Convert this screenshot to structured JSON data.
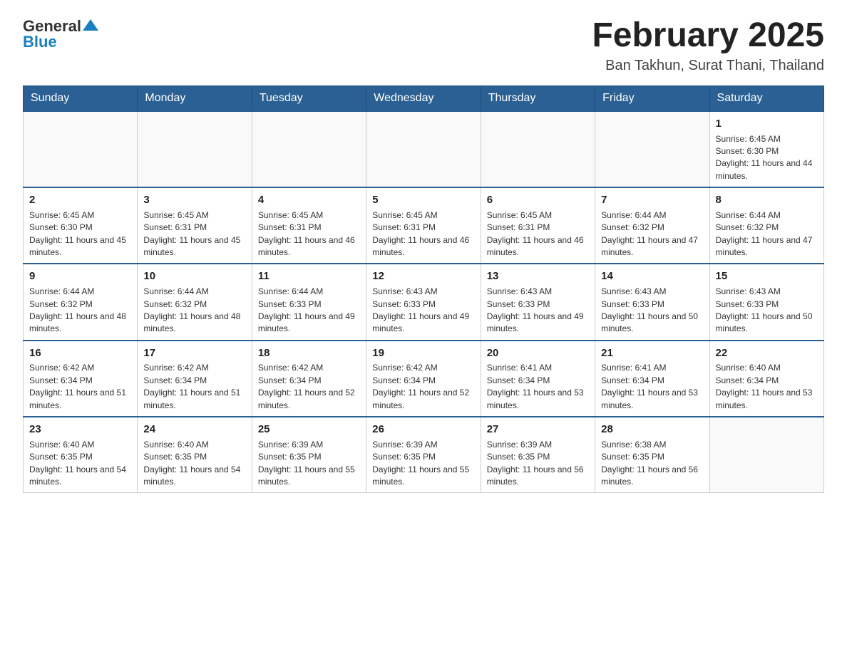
{
  "header": {
    "logo_general": "General",
    "logo_blue": "Blue",
    "month_year": "February 2025",
    "location": "Ban Takhun, Surat Thani, Thailand"
  },
  "days_of_week": [
    "Sunday",
    "Monday",
    "Tuesday",
    "Wednesday",
    "Thursday",
    "Friday",
    "Saturday"
  ],
  "weeks": [
    [
      {
        "day": "",
        "info": ""
      },
      {
        "day": "",
        "info": ""
      },
      {
        "day": "",
        "info": ""
      },
      {
        "day": "",
        "info": ""
      },
      {
        "day": "",
        "info": ""
      },
      {
        "day": "",
        "info": ""
      },
      {
        "day": "1",
        "info": "Sunrise: 6:45 AM\nSunset: 6:30 PM\nDaylight: 11 hours and 44 minutes."
      }
    ],
    [
      {
        "day": "2",
        "info": "Sunrise: 6:45 AM\nSunset: 6:30 PM\nDaylight: 11 hours and 45 minutes."
      },
      {
        "day": "3",
        "info": "Sunrise: 6:45 AM\nSunset: 6:31 PM\nDaylight: 11 hours and 45 minutes."
      },
      {
        "day": "4",
        "info": "Sunrise: 6:45 AM\nSunset: 6:31 PM\nDaylight: 11 hours and 46 minutes."
      },
      {
        "day": "5",
        "info": "Sunrise: 6:45 AM\nSunset: 6:31 PM\nDaylight: 11 hours and 46 minutes."
      },
      {
        "day": "6",
        "info": "Sunrise: 6:45 AM\nSunset: 6:31 PM\nDaylight: 11 hours and 46 minutes."
      },
      {
        "day": "7",
        "info": "Sunrise: 6:44 AM\nSunset: 6:32 PM\nDaylight: 11 hours and 47 minutes."
      },
      {
        "day": "8",
        "info": "Sunrise: 6:44 AM\nSunset: 6:32 PM\nDaylight: 11 hours and 47 minutes."
      }
    ],
    [
      {
        "day": "9",
        "info": "Sunrise: 6:44 AM\nSunset: 6:32 PM\nDaylight: 11 hours and 48 minutes."
      },
      {
        "day": "10",
        "info": "Sunrise: 6:44 AM\nSunset: 6:32 PM\nDaylight: 11 hours and 48 minutes."
      },
      {
        "day": "11",
        "info": "Sunrise: 6:44 AM\nSunset: 6:33 PM\nDaylight: 11 hours and 49 minutes."
      },
      {
        "day": "12",
        "info": "Sunrise: 6:43 AM\nSunset: 6:33 PM\nDaylight: 11 hours and 49 minutes."
      },
      {
        "day": "13",
        "info": "Sunrise: 6:43 AM\nSunset: 6:33 PM\nDaylight: 11 hours and 49 minutes."
      },
      {
        "day": "14",
        "info": "Sunrise: 6:43 AM\nSunset: 6:33 PM\nDaylight: 11 hours and 50 minutes."
      },
      {
        "day": "15",
        "info": "Sunrise: 6:43 AM\nSunset: 6:33 PM\nDaylight: 11 hours and 50 minutes."
      }
    ],
    [
      {
        "day": "16",
        "info": "Sunrise: 6:42 AM\nSunset: 6:34 PM\nDaylight: 11 hours and 51 minutes."
      },
      {
        "day": "17",
        "info": "Sunrise: 6:42 AM\nSunset: 6:34 PM\nDaylight: 11 hours and 51 minutes."
      },
      {
        "day": "18",
        "info": "Sunrise: 6:42 AM\nSunset: 6:34 PM\nDaylight: 11 hours and 52 minutes."
      },
      {
        "day": "19",
        "info": "Sunrise: 6:42 AM\nSunset: 6:34 PM\nDaylight: 11 hours and 52 minutes."
      },
      {
        "day": "20",
        "info": "Sunrise: 6:41 AM\nSunset: 6:34 PM\nDaylight: 11 hours and 53 minutes."
      },
      {
        "day": "21",
        "info": "Sunrise: 6:41 AM\nSunset: 6:34 PM\nDaylight: 11 hours and 53 minutes."
      },
      {
        "day": "22",
        "info": "Sunrise: 6:40 AM\nSunset: 6:34 PM\nDaylight: 11 hours and 53 minutes."
      }
    ],
    [
      {
        "day": "23",
        "info": "Sunrise: 6:40 AM\nSunset: 6:35 PM\nDaylight: 11 hours and 54 minutes."
      },
      {
        "day": "24",
        "info": "Sunrise: 6:40 AM\nSunset: 6:35 PM\nDaylight: 11 hours and 54 minutes."
      },
      {
        "day": "25",
        "info": "Sunrise: 6:39 AM\nSunset: 6:35 PM\nDaylight: 11 hours and 55 minutes."
      },
      {
        "day": "26",
        "info": "Sunrise: 6:39 AM\nSunset: 6:35 PM\nDaylight: 11 hours and 55 minutes."
      },
      {
        "day": "27",
        "info": "Sunrise: 6:39 AM\nSunset: 6:35 PM\nDaylight: 11 hours and 56 minutes."
      },
      {
        "day": "28",
        "info": "Sunrise: 6:38 AM\nSunset: 6:35 PM\nDaylight: 11 hours and 56 minutes."
      },
      {
        "day": "",
        "info": ""
      }
    ]
  ]
}
